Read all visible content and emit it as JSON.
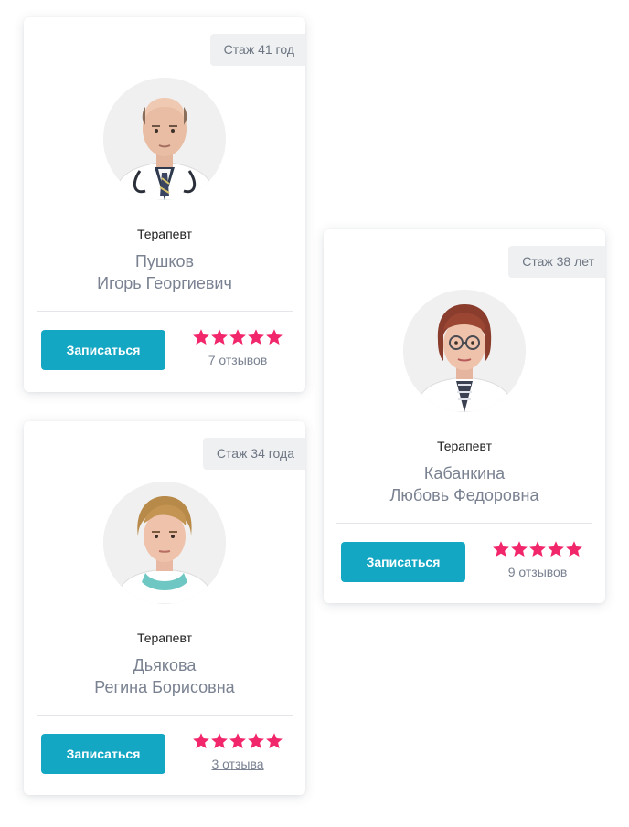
{
  "colors": {
    "accent": "#13a7c3",
    "star": "#f2266b",
    "name_text": "#7a8291",
    "badge_bg": "#eef0f2"
  },
  "cards": [
    {
      "experience": "Стаж 41 год",
      "specialty": "Терапевт",
      "last_name": "Пушков",
      "first_names": "Игорь Георгиевич",
      "button_label": "Записаться",
      "rating": 5,
      "reviews": "7 отзывов",
      "photo_icon": "doctor-photo"
    },
    {
      "experience": "Стаж 38 лет",
      "specialty": "Терапевт",
      "last_name": "Кабанкина",
      "first_names": "Любовь Федоровна",
      "button_label": "Записаться",
      "rating": 5,
      "reviews": "9 отзывов",
      "photo_icon": "doctor-photo"
    },
    {
      "experience": "Стаж 34 года",
      "specialty": "Терапевт",
      "last_name": "Дьякова",
      "first_names": "Регина Борисовна",
      "button_label": "Записаться",
      "rating": 5,
      "reviews": "3 отзыва",
      "photo_icon": "doctor-photo"
    }
  ]
}
